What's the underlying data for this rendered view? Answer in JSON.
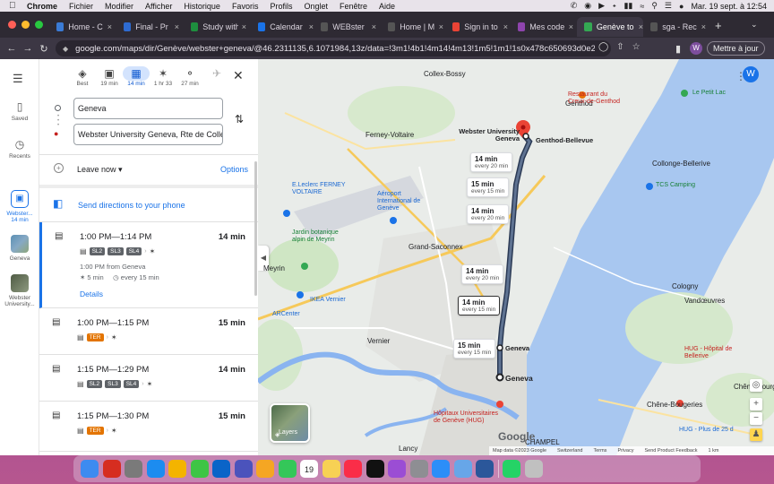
{
  "menubar": {
    "app": "Chrome",
    "items": [
      "Fichier",
      "Modifier",
      "Afficher",
      "Historique",
      "Favoris",
      "Profils",
      "Onglet",
      "Fenêtre",
      "Aide"
    ],
    "clock": "Mar. 19 sept. à 12:54"
  },
  "tabs": [
    {
      "label": "Home - C",
      "fav_color": "#3a7bd5",
      "fav_icon": "home-icon"
    },
    {
      "label": "Final - Pr",
      "fav_color": "#2e6bd1",
      "fav_icon": "doc-icon"
    },
    {
      "label": "Study with",
      "fav_color": "#1e8e3e",
      "fav_icon": "book-icon"
    },
    {
      "label": "Calendar",
      "fav_color": "#1a73e8",
      "fav_icon": "calendar-icon"
    },
    {
      "label": "WEBster",
      "fav_color": "#555555",
      "fav_icon": "globe-icon"
    },
    {
      "label": "Home | M",
      "fav_color": "#555555",
      "fav_icon": "globe-icon"
    },
    {
      "label": "Sign in to",
      "fav_color": "#ea4335",
      "fav_icon": "google-icon"
    },
    {
      "label": "Mes code",
      "fav_color": "#8e44ad",
      "fav_icon": "code-icon"
    },
    {
      "label": "Genève to",
      "fav_color": "#34a853",
      "fav_icon": "maps-icon"
    },
    {
      "label": "sga - Rec",
      "fav_color": "#555555",
      "fav_icon": "google-icon"
    }
  ],
  "toolbar": {
    "url": "google.com/maps/dir/Genève/webster+geneva/@46.2311135,6.1071984,13z/data=!3m1!4b1!4m14!4m13!1m5!1m1!1s0x478c650693d0e2eb:0xa",
    "avatar_letter": "W",
    "update_label": "Mettre à jour"
  },
  "rail": {
    "saved": "Saved",
    "recents": "Recents",
    "current_title": "Webster...",
    "current_sub": "14 min",
    "geneva": "Geneva",
    "webster_univ": "Webster University..."
  },
  "modes": [
    {
      "label": "Best",
      "icon": "directions-icon"
    },
    {
      "label": "19 min",
      "icon": "car-icon"
    },
    {
      "label": "14 min",
      "icon": "transit-icon"
    },
    {
      "label": "1 hr 33",
      "icon": "walk-icon"
    },
    {
      "label": "27 min",
      "icon": "bike-icon"
    },
    {
      "label": "",
      "icon": "plane-icon"
    }
  ],
  "directions": {
    "origin": "Geneva",
    "destination": "Webster University Geneva, Rte de Collex",
    "leave_label": "Leave now",
    "options_label": "Options",
    "send_label": "Send directions to your phone"
  },
  "routes": [
    {
      "times": "1:00 PM—1:14 PM",
      "duration": "14 min",
      "chips": [
        "SL2",
        "SL3",
        "SL4"
      ],
      "from": "1:00 PM from Geneva",
      "walk": "5 min",
      "every": "every 15 min",
      "details": "Details"
    },
    {
      "times": "1:00 PM—1:15 PM",
      "duration": "15 min",
      "chips": [
        "TER"
      ]
    },
    {
      "times": "1:15 PM—1:29 PM",
      "duration": "14 min",
      "chips": [
        "SL2",
        "SL3",
        "SL4"
      ]
    },
    {
      "times": "1:15 PM—1:30 PM",
      "duration": "15 min",
      "chips": [
        "TER"
      ]
    }
  ],
  "map": {
    "labels": {
      "collex": "Collex-Bossy",
      "genthod": "Genthod",
      "webster": "Webster University Geneva",
      "genthod_bellevue": "Genthod-Bellevue",
      "ferney": "Ferney-Voltaire",
      "leclerc_ferney": "E.Leclerc FERNEY VOLTAIRE",
      "aeroport": "Aéroport International de Genève",
      "jardin": "Jardin botanique alpin de Meyrin",
      "grand_saconnex": "Grand-Saconnex",
      "meyrin": "Meyrin",
      "ikea": "IKEA Vernier",
      "arcenter": "ARCenter",
      "vernier": "Vernier",
      "geneva": "Geneva",
      "geneva_station": "Geneva",
      "collonge": "Collonge-Bellerive",
      "tcs": "TCS Camping",
      "cologny": "Cologny",
      "vandoeuvres": "Vandœuvres",
      "hug_belle": "HUG - Hôpital de Bellerive",
      "hug": "Hôpitaux Universitaires de Genève (HUG)",
      "chene_bourg": "Chêne-Bourg",
      "thonex": "Chêne-Bougeries",
      "lancy": "Lancy",
      "champel": "CHAMPEL",
      "restaurant": "Restaurant du Creux-de-Genthod",
      "lepetit": "Le Petit Lac",
      "leclerc_thoiry": "E.Leclerc",
      "plaine": "Plainpalais",
      "hug_pius": "HUG - Plus de 25 d"
    },
    "bubbles": [
      {
        "main": "14 min",
        "sub": "every 20 min"
      },
      {
        "main": "15 min",
        "sub": "every 15 min"
      },
      {
        "main": "14 min",
        "sub": "every 20 min"
      },
      {
        "main": "14 min",
        "sub": "every 20 min"
      },
      {
        "main": "14 min",
        "sub": "every 15 min"
      },
      {
        "main": "15 min",
        "sub": "every 15 min"
      }
    ],
    "layers_label": "Layers",
    "footer": [
      "Map data ©2023 Google",
      "Switzerland",
      "Terms",
      "Privacy",
      "Send Product Feedback",
      "1 km"
    ],
    "google_logo": "Google",
    "avatar_letter": "W"
  },
  "dock": {
    "icons": [
      "finder-icon",
      "acrobat-icon",
      "launchpad-icon",
      "safari-icon",
      "chrome-icon",
      "messages-icon",
      "outlook-icon",
      "teams-icon",
      "photos-icon",
      "facetime-icon",
      "calendar-icon",
      "notes-icon",
      "music-icon",
      "appletv-icon",
      "podcasts-icon",
      "settings-icon",
      "keynote-icon",
      "preview-icon",
      "word-icon",
      "whatsapp-icon",
      "trash-icon"
    ],
    "calendar_day": "19"
  }
}
